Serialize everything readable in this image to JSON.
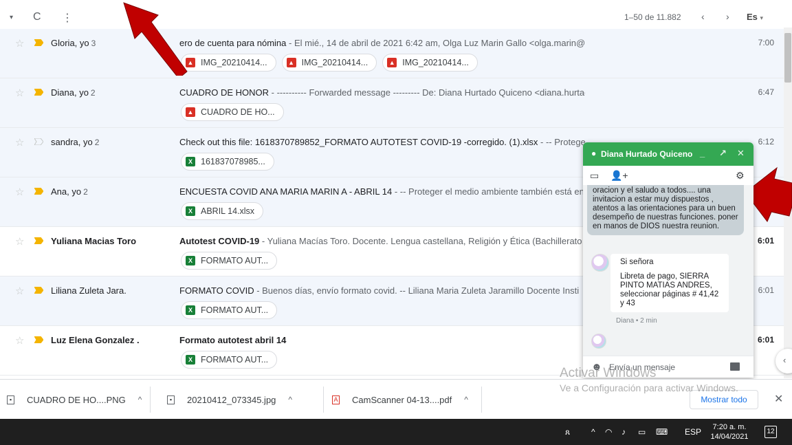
{
  "toolbar": {
    "select_icon": "caret-down-icon",
    "refresh_icon": "refresh-icon",
    "more_icon": "more-vert-icon",
    "pagination": "1–50 de 11.882",
    "prev": "‹",
    "next": "›",
    "language": "Es"
  },
  "emails": [
    {
      "sender": "Gloria, yo",
      "count": "3",
      "unread": false,
      "important": true,
      "subject": "ero de cuenta para nómina",
      "snippet": " - El mié., 14 de abril de 2021 6:42 am, Olga Luz Marin Gallo <olga.marin@elrosariodebello.edu.c...",
      "time": "7:00",
      "attachments": [
        {
          "name": "IMG_20210414...",
          "type": "image"
        },
        {
          "name": "IMG_20210414...",
          "type": "image"
        },
        {
          "name": "IMG_20210414...",
          "type": "image"
        }
      ]
    },
    {
      "sender": "Diana, yo",
      "count": "2",
      "unread": false,
      "important": true,
      "subject": "CUADRO DE HONOR",
      "snippet": " - ---------- Forwarded message --------- De: Diana Hurtado Quiceno <diana.hurtado@elrosariodebello.edu.co> D...",
      "time": "6:47",
      "attachments": [
        {
          "name": "CUADRO DE HO...",
          "type": "image"
        }
      ]
    },
    {
      "sender": "sandra, yo",
      "count": "2",
      "unread": false,
      "important": false,
      "subject": "Check out this file: 1618370789852_FORMATO AUTOTEST COVID-19 -corregido. (1).xlsx",
      "snippet": " - -- Protege",
      "time": "6:12",
      "attachments": [
        {
          "name": "161837078985...",
          "type": "sheet"
        }
      ]
    },
    {
      "sender": "Ana, yo",
      "count": "2",
      "unread": false,
      "important": true,
      "subject": "ENCUESTA COVID ANA MARIA MARIN A - ABRIL 14",
      "snippet": " - -- Proteger el medio ambiente también está en",
      "time": "",
      "attachments": [
        {
          "name": "ABRIL 14.xlsx",
          "type": "sheet"
        }
      ]
    },
    {
      "sender": "Yuliana Macias Toro",
      "count": "",
      "unread": true,
      "important": true,
      "subject": "Autotest COVID-19",
      "snippet": " - Yuliana Macías Toro. Docente. Lengua castellana, Religión y Ética (Bachillerato",
      "time": "6:01",
      "attachments": [
        {
          "name": "FORMATO AUT...",
          "type": "sheet"
        }
      ]
    },
    {
      "sender": "Liliana Zuleta Jara.",
      "count": "",
      "unread": false,
      "important": true,
      "subject": "FORMATO COVID",
      "snippet": " - Buenos días, envío formato covid. -- Liliana Maria Zuleta Jaramillo Docente Insti",
      "time": "6:01",
      "attachments": [
        {
          "name": "FORMATO AUT...",
          "type": "sheet"
        }
      ]
    },
    {
      "sender": "Luz Elena Gonzalez .",
      "count": "",
      "unread": true,
      "important": true,
      "subject": "Formato autotest abril 14",
      "snippet": "",
      "time": "6:01",
      "attachments": [
        {
          "name": "FORMATO AUT...",
          "type": "sheet"
        }
      ]
    }
  ],
  "chat": {
    "contact": "Diana Hurtado Quiceno",
    "my_message": "oracion y el saludo a todos.... una invitacion a estar muy dispuestos , atentos  a las  orientaciones para un buen desempeño de nuestras funciones.  poner en manos de DIOS   nuestra reunion.",
    "their_greeting": "Si señora",
    "their_message": "Libreta de pago, SIERRA PINTO MATIAS ANDRES, seleccionar páginas # 41,42 y 43",
    "meta": "Diana • 2 min",
    "input_placeholder": "Envía un mensaje",
    "header_colour": "#34a853"
  },
  "downloads": {
    "items": [
      {
        "name": "CUADRO DE HO....PNG",
        "type": "image"
      },
      {
        "name": "20210412_073345.jpg",
        "type": "image"
      },
      {
        "name": "CamScanner 04-13....pdf",
        "type": "pdf"
      }
    ],
    "show_all": "Mostrar todo",
    "close": "✕"
  },
  "watermark": {
    "line1": "Activar Windows",
    "line2": "Ve a Configuración para activar Windows."
  },
  "taskbar": {
    "language": "ESP",
    "time": "7:20 a. m.",
    "date": "14/04/2021",
    "notifications": "12"
  },
  "annotation_colour": "#c00000"
}
